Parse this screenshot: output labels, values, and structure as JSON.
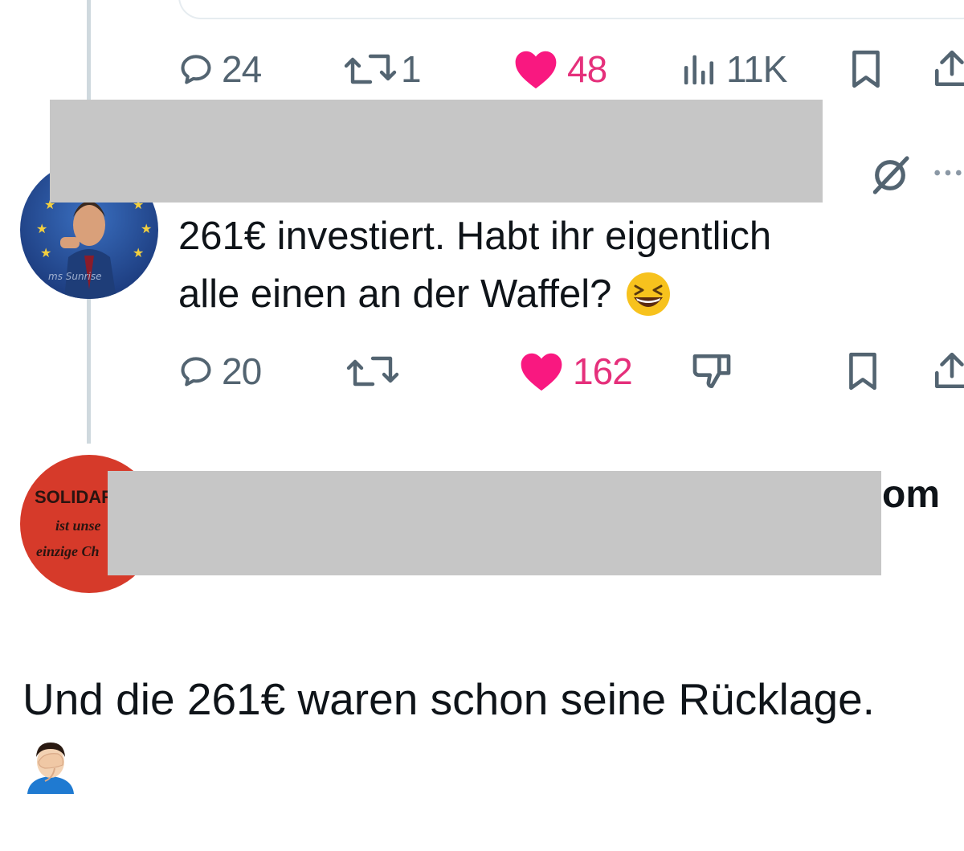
{
  "tweet1": {
    "actions": {
      "replies": "24",
      "reposts": "1",
      "likes": "48",
      "views": "11K"
    }
  },
  "tweet2": {
    "text_line1": "261€ investiert. Habt ihr eigentlich",
    "text_line2": "alle einen an der Waffel?",
    "emoji": "grinning-squinting-face",
    "avatar_watermark": "ms Sunrise",
    "actions": {
      "replies": "20",
      "likes": "162"
    }
  },
  "tweet3": {
    "avatar_text": [
      "SOLIDAR",
      "ist unse",
      "einzige Ch"
    ],
    "name_fragment": "om"
  },
  "caption": {
    "text": "Und die 261€ waren schon seine Rücklage.",
    "emoji": "man-facepalming"
  },
  "colors": {
    "like": "#f91880",
    "icon_gray": "#536471",
    "redaction": "#c6c6c6",
    "thread_line": "#cfd9de"
  },
  "icons": [
    "reply-icon",
    "repost-icon",
    "heart-icon",
    "views-icon",
    "bookmark-icon",
    "share-icon",
    "grok-icon",
    "more-icon",
    "downvote-icon"
  ]
}
